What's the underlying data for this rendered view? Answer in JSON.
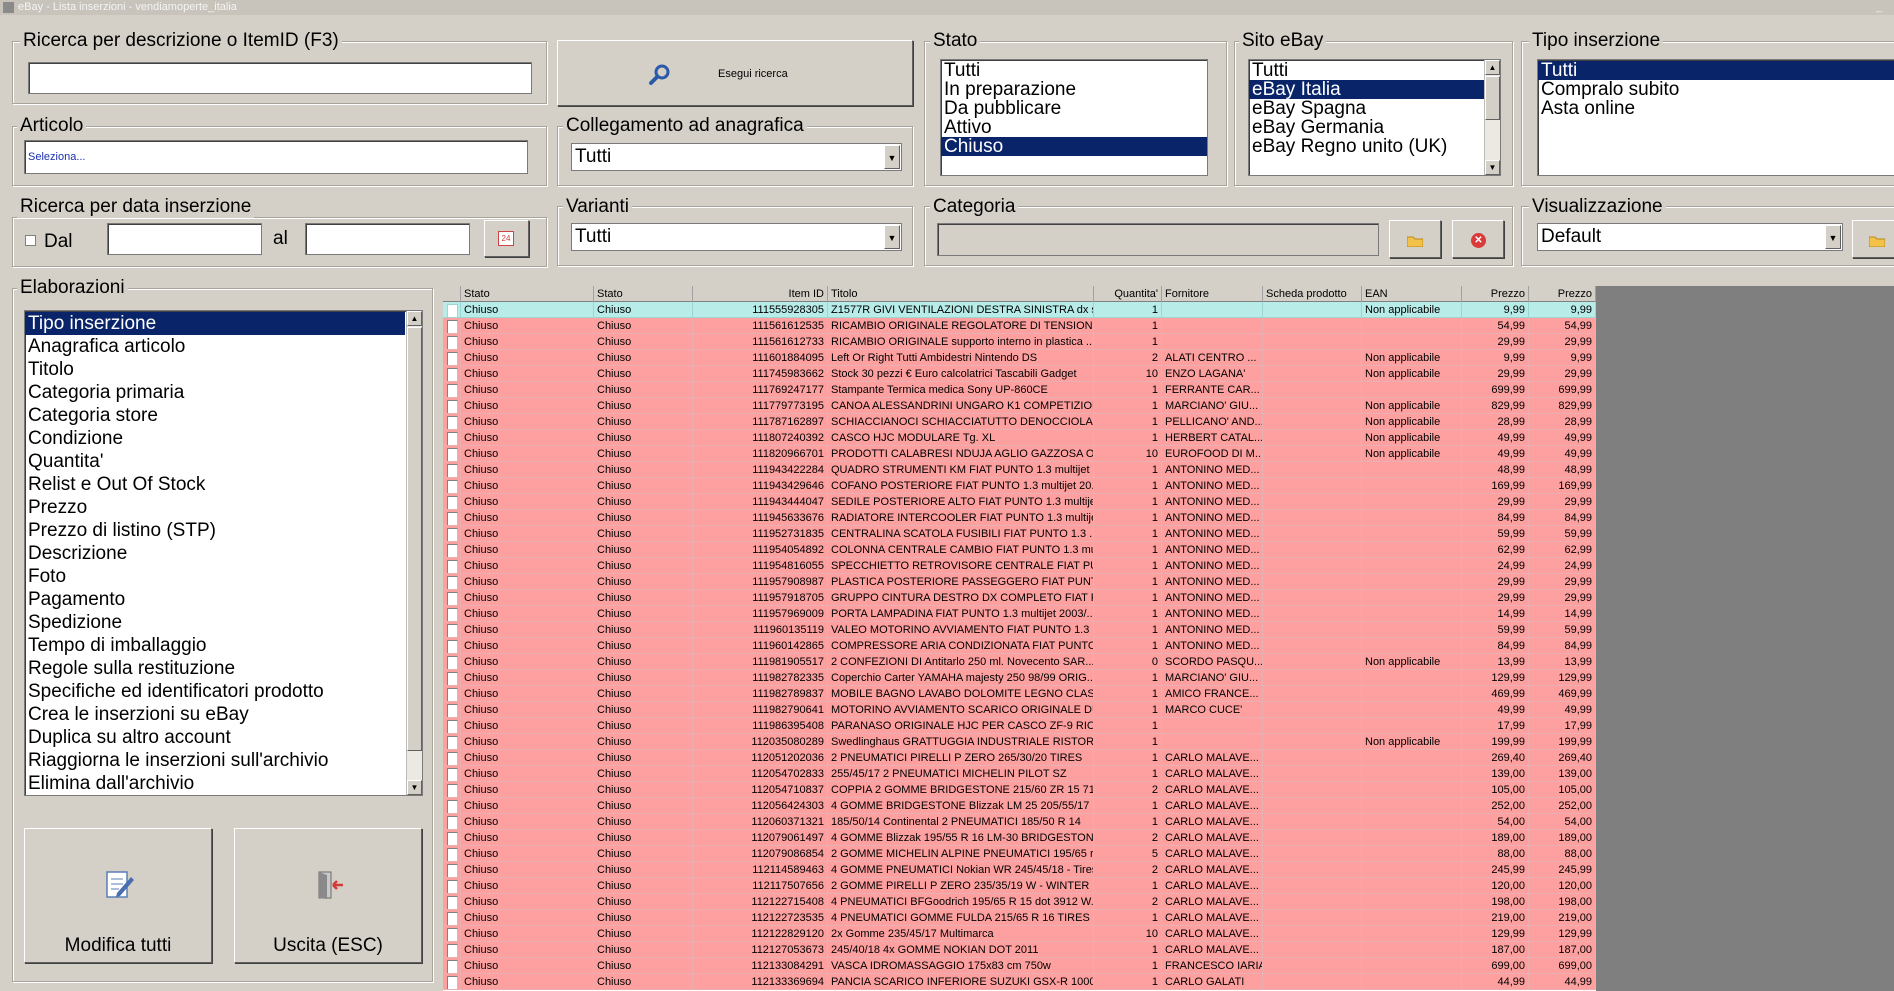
{
  "window": {
    "title": "eBay - Lista inserzioni - vendiamoperte_italia",
    "min_glyph": "_"
  },
  "search": {
    "group_label": "Ricerca per descrizione o ItemID (F3)",
    "value": "",
    "button_label": "Esegui ricerca"
  },
  "articolo": {
    "group_label": "Articolo",
    "placeholder": "Seleziona..."
  },
  "collegamento": {
    "group_label": "Collegamento ad anagrafica",
    "value": "Tutti"
  },
  "data_ins": {
    "group_label": "Ricerca per data inserzione",
    "dal_label": "Dal",
    "al_label": "al",
    "dal_value": "",
    "al_value": "",
    "calendar_text": "24"
  },
  "varianti": {
    "group_label": "Varianti",
    "value": "Tutti"
  },
  "stato": {
    "group_label": "Stato",
    "items": [
      "Tutti",
      "In preparazione",
      "Da pubblicare",
      "Attivo",
      "Chiuso"
    ],
    "selected": "Chiuso"
  },
  "sito": {
    "group_label": "Sito eBay",
    "items": [
      "Tutti",
      "eBay Italia",
      "eBay Spagna",
      "eBay Germania",
      "eBay Regno unito (UK)"
    ],
    "selected": "eBay Italia"
  },
  "tipo": {
    "group_label": "Tipo inserzione",
    "items": [
      "Tutti",
      "Compralo subito",
      "Asta online"
    ],
    "selected": "Tutti"
  },
  "categoria": {
    "group_label": "Categoria",
    "value": ""
  },
  "visualizzazione": {
    "group_label": "Visualizzazione",
    "value": "Default"
  },
  "elaborazioni": {
    "group_label": "Elaborazioni",
    "items": [
      "Tipo inserzione",
      "Anagrafica articolo",
      "Titolo",
      "Categoria primaria",
      "Categoria store",
      "Condizione",
      "Quantita'",
      "Relist e Out Of Stock",
      "Prezzo",
      "Prezzo di listino (STP)",
      "Descrizione",
      "Foto",
      "Pagamento",
      "Spedizione",
      "Tempo di imballaggio",
      "Regole sulla restituzione",
      "Specifiche ed identificatori prodotto",
      "Crea le inserzioni su eBay",
      "Duplica su altro account",
      "Riaggiorna le inserzioni sull'archivio",
      "Elimina dall'archivio"
    ],
    "selected": "Tipo inserzione"
  },
  "buttons": {
    "modifica": "Modifica tutti",
    "uscita": "Uscita (ESC)"
  },
  "grid": {
    "headers": [
      "",
      "Stato",
      "Stato",
      "Item ID",
      "Titolo",
      "Quantita'",
      "Fornitore",
      "Scheda prodotto",
      "EAN",
      "Prezzo",
      "Prezzo"
    ],
    "rows": [
      [
        "Chiuso",
        "Chiuso",
        "111555928305",
        "Z1577R GIVI VENTILAZIONI DESTRA SINISTRA dx s...",
        "1",
        "",
        "",
        "Non applicabile",
        "9,99",
        "9,99"
      ],
      [
        "Chiuso",
        "Chiuso",
        "111561612535",
        "RICAMBIO ORIGINALE REGOLATORE DI TENSIONE ...",
        "1",
        "",
        "",
        "",
        "54,99",
        "54,99"
      ],
      [
        "Chiuso",
        "Chiuso",
        "111561612733",
        "RICAMBIO ORIGINALE supporto interno in plastica ...",
        "1",
        "",
        "",
        "",
        "29,99",
        "29,99"
      ],
      [
        "Chiuso",
        "Chiuso",
        "111601884095",
        "Left Or Right Tutti Ambidestri Nintendo DS",
        "2",
        "ALATI CENTRO ...",
        "",
        "Non applicabile",
        "9,99",
        "9,99"
      ],
      [
        "Chiuso",
        "Chiuso",
        "111745983662",
        "Stock 30 pezzi € Euro calcolatrici Tascabili Gadget",
        "10",
        "ENZO LAGANA'",
        "",
        "Non applicabile",
        "29,99",
        "29,99"
      ],
      [
        "Chiuso",
        "Chiuso",
        "111769247177",
        "Stampante Termica medica Sony UP-860CE",
        "1",
        "FERRANTE CAR...",
        "",
        "",
        "699,99",
        "699,99"
      ],
      [
        "Chiuso",
        "Chiuso",
        "111779773195",
        "CANOA ALESSANDRINI UNGARO K1 COMPETIZION...",
        "1",
        "MARCIANO' GIU...",
        "",
        "Non applicabile",
        "829,99",
        "829,99"
      ],
      [
        "Chiuso",
        "Chiuso",
        "111787162897",
        "SCHIACCIANOCI SCHIACCIATUTTO DENOCCIOLA ...",
        "1",
        "PELLICANO' AND...",
        "",
        "Non applicabile",
        "28,99",
        "28,99"
      ],
      [
        "Chiuso",
        "Chiuso",
        "111807240392",
        "CASCO HJC MODULARE Tg. XL",
        "1",
        "HERBERT CATAL...",
        "",
        "Non applicabile",
        "49,99",
        "49,99"
      ],
      [
        "Chiuso",
        "Chiuso",
        "111820966701",
        "PRODOTTI CALABRESI NDUJA AGLIO GAZZOSA OL...",
        "10",
        "EUROFOOD DI M...",
        "",
        "Non applicabile",
        "49,99",
        "49,99"
      ],
      [
        "Chiuso",
        "Chiuso",
        "111943422284",
        "QUADRO STRUMENTI KM FIAT PUNTO 1.3 multijet ...",
        "1",
        "ANTONINO MED...",
        "",
        "",
        "48,99",
        "48,99"
      ],
      [
        "Chiuso",
        "Chiuso",
        "111943429646",
        "COFANO POSTERIORE FIAT PUNTO 1.3 multijet 20...",
        "1",
        "ANTONINO MED...",
        "",
        "",
        "169,99",
        "169,99"
      ],
      [
        "Chiuso",
        "Chiuso",
        "111943444047",
        "SEDILE POSTERIORE ALTO FIAT PUNTO 1.3 multije...",
        "1",
        "ANTONINO MED...",
        "",
        "",
        "29,99",
        "29,99"
      ],
      [
        "Chiuso",
        "Chiuso",
        "111945633676",
        "RADIATORE INTERCOOLER FIAT PUNTO 1.3 multije...",
        "1",
        "ANTONINO MED...",
        "",
        "",
        "84,99",
        "84,99"
      ],
      [
        "Chiuso",
        "Chiuso",
        "111952731835",
        "CENTRALINA SCATOLA FUSIBILI FIAT PUNTO 1.3 ...",
        "1",
        "ANTONINO MED...",
        "",
        "",
        "59,99",
        "59,99"
      ],
      [
        "Chiuso",
        "Chiuso",
        "111954054892",
        "COLONNA CENTRALE CAMBIO FIAT PUNTO 1.3 mul...",
        "1",
        "ANTONINO MED...",
        "",
        "",
        "62,99",
        "62,99"
      ],
      [
        "Chiuso",
        "Chiuso",
        "111954816055",
        "SPECCHIETTO RETROVISORE CENTRALE FIAT PUN...",
        "1",
        "ANTONINO MED...",
        "",
        "",
        "24,99",
        "24,99"
      ],
      [
        "Chiuso",
        "Chiuso",
        "111957908987",
        "PLASTICA POSTERIORE PASSEGGERO FIAT PUNTO...",
        "1",
        "ANTONINO MED...",
        "",
        "",
        "29,99",
        "29,99"
      ],
      [
        "Chiuso",
        "Chiuso",
        "111957918705",
        "GRUPPO CINTURA DESTRO DX COMPLETO FIAT PU...",
        "1",
        "ANTONINO MED...",
        "",
        "",
        "29,99",
        "29,99"
      ],
      [
        "Chiuso",
        "Chiuso",
        "111957969009",
        "PORTA LAMPADINA FIAT PUNTO 1.3 multijet 2003/...",
        "1",
        "ANTONINO MED...",
        "",
        "",
        "14,99",
        "14,99"
      ],
      [
        "Chiuso",
        "Chiuso",
        "111960135119",
        "VALEO MOTORINO AVVIAMENTO FIAT PUNTO 1.3 ...",
        "1",
        "ANTONINO MED...",
        "",
        "",
        "59,99",
        "59,99"
      ],
      [
        "Chiuso",
        "Chiuso",
        "111960142865",
        "COMPRESSORE ARIA CONDIZIONATA FIAT PUNTO...",
        "1",
        "ANTONINO MED...",
        "",
        "",
        "84,99",
        "84,99"
      ],
      [
        "Chiuso",
        "Chiuso",
        "111981905517",
        "2 CONFEZIONI DI Antitarlo 250 ml. Novecento SAR...",
        "0",
        "SCORDO PASQU...",
        "",
        "Non applicabile",
        "13,99",
        "13,99"
      ],
      [
        "Chiuso",
        "Chiuso",
        "111982782335",
        "Coperchio Carter YAMAHA majesty 250 98/99 ORIG...",
        "1",
        "MARCIANO' GIU...",
        "",
        "",
        "129,99",
        "129,99"
      ],
      [
        "Chiuso",
        "Chiuso",
        "111982789837",
        "MOBILE BAGNO LAVABO DOLOMITE LEGNO CLASSI...",
        "1",
        "AMICO FRANCE...",
        "",
        "",
        "469,99",
        "469,99"
      ],
      [
        "Chiuso",
        "Chiuso",
        "111982790641",
        "MOTORINO AVVIAMENTO SCARICO ORIGINALE DU...",
        "1",
        "MARCO CUCE'",
        "",
        "",
        "49,99",
        "49,99"
      ],
      [
        "Chiuso",
        "Chiuso",
        "111986395408",
        "PARANASO ORIGINALE HJC PER CASCO ZF-9 RICA...",
        "1",
        "",
        "",
        "",
        "17,99",
        "17,99"
      ],
      [
        "Chiuso",
        "Chiuso",
        "112035080289",
        "Swedlinghaus GRATTUGGIA INDUSTRIALE RISTOR...",
        "1",
        "",
        "",
        "Non applicabile",
        "199,99",
        "199,99"
      ],
      [
        "Chiuso",
        "Chiuso",
        "112051202036",
        "2 PNEUMATICI PIRELLI P ZERO 265/30/20 TIRES",
        "1",
        "CARLO MALAVE...",
        "",
        "",
        "269,40",
        "269,40"
      ],
      [
        "Chiuso",
        "Chiuso",
        "112054702833",
        "255/45/17 2 PNEUMATICI MICHELIN PILOT SZ",
        "1",
        "CARLO MALAVE...",
        "",
        "",
        "139,00",
        "139,00"
      ],
      [
        "Chiuso",
        "Chiuso",
        "112054710837",
        "COPPIA 2 GOMME BRIDGESTONE 215/60 ZR 15 71G...",
        "2",
        "CARLO MALAVE...",
        "",
        "",
        "105,00",
        "105,00"
      ],
      [
        "Chiuso",
        "Chiuso",
        "112056424303",
        "4 GOMME BRIDGESTONE Blizzak LM 25 205/55/17 R...",
        "1",
        "CARLO MALAVE...",
        "",
        "",
        "252,00",
        "252,00"
      ],
      [
        "Chiuso",
        "Chiuso",
        "112060371321",
        "185/50/14 Continental 2 PNEUMATICI 185/50 R 14",
        "1",
        "CARLO MALAVE...",
        "",
        "",
        "54,00",
        "54,00"
      ],
      [
        "Chiuso",
        "Chiuso",
        "112079061497",
        "4 GOMME Blizzak 195/55 R 16 LM-30 BRIDGESTONE ...",
        "2",
        "CARLO MALAVE...",
        "",
        "",
        "189,00",
        "189,00"
      ],
      [
        "Chiuso",
        "Chiuso",
        "112079086854",
        "2 GOMME MICHELIN ALPINE PNEUMATICI 195/65 r...",
        "5",
        "CARLO MALAVE...",
        "",
        "",
        "88,00",
        "88,00"
      ],
      [
        "Chiuso",
        "Chiuso",
        "112114589463",
        "4 GOMME PNEUMATICI Nokian WR 245/45/18 - Tires",
        "2",
        "CARLO MALAVE...",
        "",
        "",
        "245,99",
        "245,99"
      ],
      [
        "Chiuso",
        "Chiuso",
        "112117507656",
        "2 GOMME PIRELLI P ZERO 235/35/19 W - WINTER ...",
        "1",
        "CARLO MALAVE...",
        "",
        "",
        "120,00",
        "120,00"
      ],
      [
        "Chiuso",
        "Chiuso",
        "112122715408",
        "4 PNEUMATICI BFGoodrich 195/65 R 15 dot 3912 W...",
        "2",
        "CARLO MALAVE...",
        "",
        "",
        "198,00",
        "198,00"
      ],
      [
        "Chiuso",
        "Chiuso",
        "112122723535",
        "4 PNEUMATICI GOMME FULDA 215/65 R 16 TIRES",
        "1",
        "CARLO MALAVE...",
        "",
        "",
        "219,00",
        "219,00"
      ],
      [
        "Chiuso",
        "Chiuso",
        "112122829120",
        "2x Gomme 235/45/17 Multimarca",
        "10",
        "CARLO MALAVE...",
        "",
        "",
        "129,99",
        "129,99"
      ],
      [
        "Chiuso",
        "Chiuso",
        "112127053673",
        "245/40/18 4x GOMME NOKIAN DOT 2011",
        "1",
        "CARLO MALAVE...",
        "",
        "",
        "187,00",
        "187,00"
      ],
      [
        "Chiuso",
        "Chiuso",
        "112133084291",
        "VASCA IDROMASSAGGIO 175x83 cm 750w",
        "1",
        "FRANCESCO IARIA",
        "",
        "",
        "699,00",
        "699,00"
      ],
      [
        "Chiuso",
        "Chiuso",
        "112133369694",
        "PANCIA SCARICO INFERIORE SUZUKI GSX-R 1000 ...",
        "1",
        "CARLO GALATI",
        "",
        "",
        "44,99",
        "44,99"
      ]
    ]
  }
}
